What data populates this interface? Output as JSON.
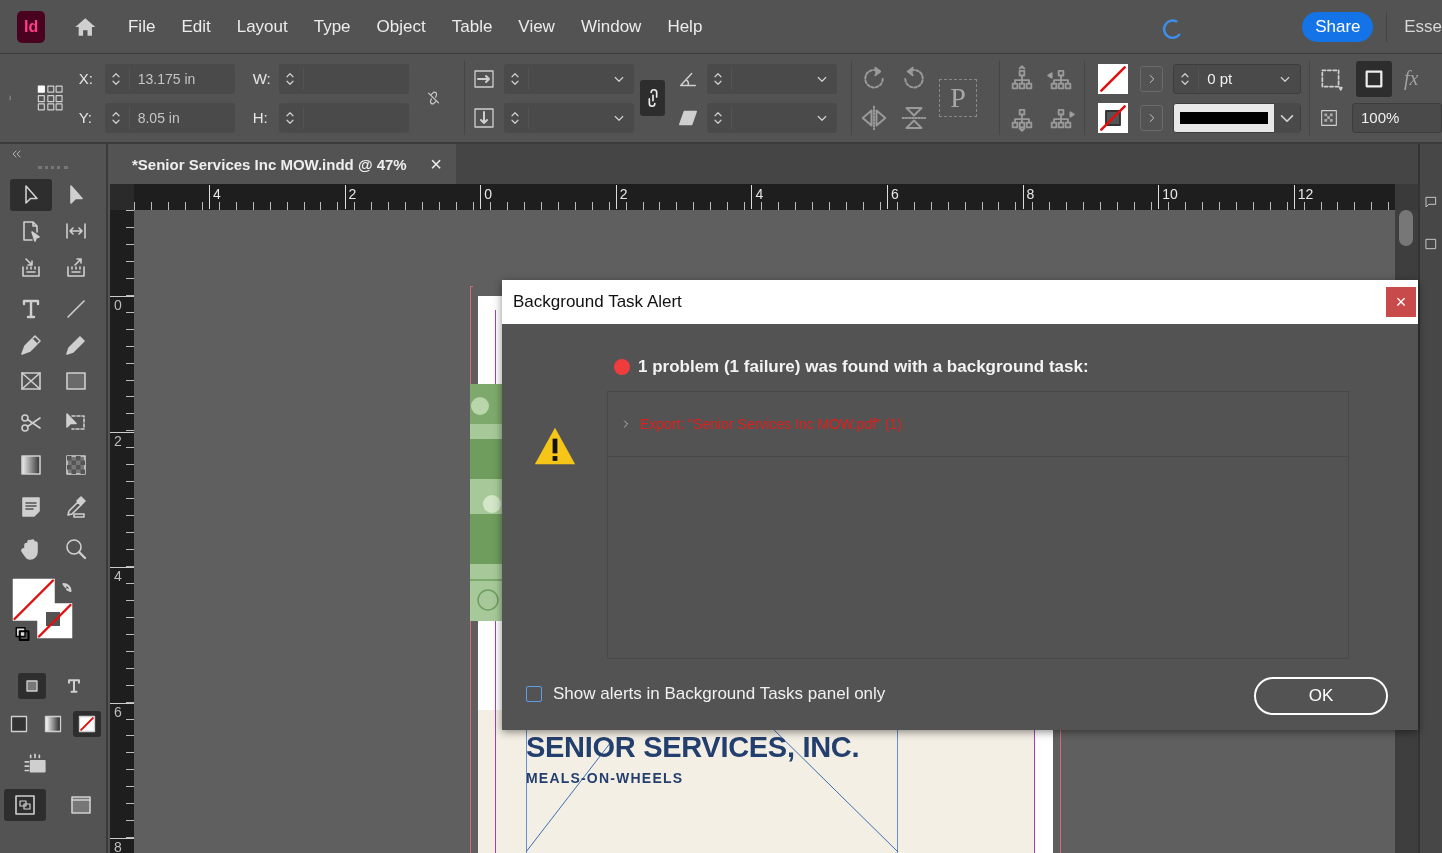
{
  "app_logo": "Id",
  "menu": [
    "File",
    "Edit",
    "Layout",
    "Type",
    "Object",
    "Table",
    "View",
    "Window",
    "Help"
  ],
  "share_button": "Share",
  "workspace_label": "Esse",
  "control_panel": {
    "x": {
      "label": "X:",
      "value": "13.175 in"
    },
    "y": {
      "label": "Y:",
      "value": "8.05 in"
    },
    "w": {
      "label": "W:"
    },
    "h": {
      "label": "H:"
    },
    "proxy_letter": "P",
    "stroke_weight": "0 pt",
    "opacity": "100%",
    "effects_label": "fx"
  },
  "tools": [
    {
      "kind": "selection",
      "selected": true
    },
    {
      "kind": "direct-selection",
      "selected": false
    },
    {
      "kind": "page",
      "selected": false
    },
    {
      "kind": "gap",
      "selected": false
    },
    {
      "kind": "collector",
      "selected": false
    },
    {
      "kind": "placer",
      "selected": false
    },
    {
      "kind": "type",
      "selected": false
    },
    {
      "kind": "line",
      "selected": false
    },
    {
      "kind": "pen",
      "selected": false
    },
    {
      "kind": "pencil",
      "selected": false
    },
    {
      "kind": "frame",
      "selected": false
    },
    {
      "kind": "rectangle",
      "selected": false
    },
    {
      "kind": "scissors",
      "selected": false
    },
    {
      "kind": "transform",
      "selected": false
    },
    {
      "kind": "gradient",
      "selected": false
    },
    {
      "kind": "feather",
      "selected": false
    },
    {
      "kind": "note",
      "selected": false
    },
    {
      "kind": "eyedropper",
      "selected": false
    },
    {
      "kind": "hand",
      "selected": false
    },
    {
      "kind": "zoom",
      "selected": false
    }
  ],
  "format_toggles": [
    {
      "kind": "container",
      "selected": true
    },
    {
      "kind": "text",
      "selected": false
    }
  ],
  "apply_buttons": [
    {
      "kind": "color",
      "selected": false
    },
    {
      "kind": "gradient",
      "selected": false
    },
    {
      "kind": "none",
      "selected": true
    }
  ],
  "screen_modes": [
    {
      "kind": "normal",
      "selected": true
    },
    {
      "kind": "preview",
      "selected": false
    }
  ],
  "document_tab": {
    "title": "*Senior Services Inc MOW.indd @ 47%",
    "close": "×",
    "selected": true
  },
  "horizontal_ruler": [
    "4",
    "2",
    "0",
    "2",
    "4",
    "6",
    "8",
    "10",
    "12"
  ],
  "vertical_ruler": [
    "0",
    "2",
    "4",
    "6",
    "8"
  ],
  "page": {
    "heading": "SENIOR SERVICES, INC.",
    "subheading": "MEALS-ON-WHEELS"
  },
  "dialog": {
    "title": "Background Task Alert",
    "close": "×",
    "message": "1 problem (1 failure) was found with a background task:",
    "tasks": [
      {
        "label": "Export: \"Senior Services Inc MOW.pdf\" (1)",
        "expanded": false
      }
    ],
    "checkbox": {
      "label": "Show alerts in Background Tasks panel only",
      "checked": false
    },
    "ok_button": "OK"
  }
}
